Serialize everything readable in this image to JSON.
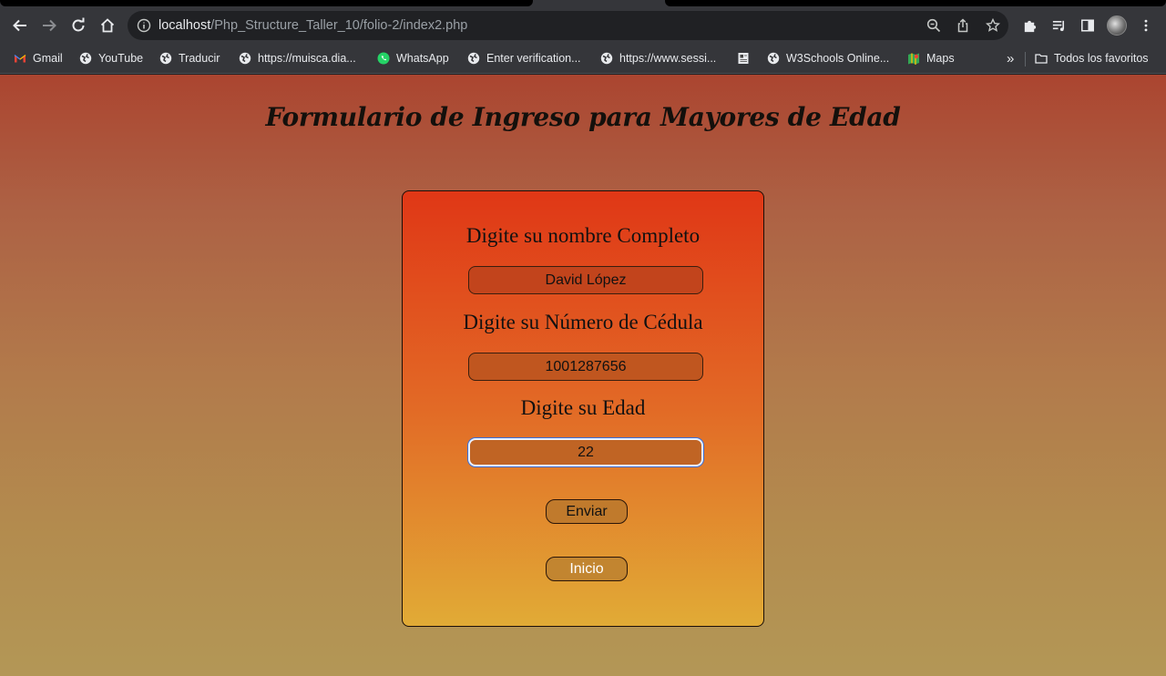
{
  "browser": {
    "url_host": "localhost",
    "url_path": "/Php_Structure_Taller_10/folio-2/index2.php",
    "bookmarks": [
      {
        "label": "Gmail",
        "icon": "gmail-icon"
      },
      {
        "label": "YouTube",
        "icon": "globe-icon"
      },
      {
        "label": "Traducir",
        "icon": "globe-icon"
      },
      {
        "label": "https://muisca.dia...",
        "icon": "globe-icon"
      },
      {
        "label": "WhatsApp",
        "icon": "whatsapp-icon"
      },
      {
        "label": "Enter verification...",
        "icon": "globe-icon"
      },
      {
        "label": "https://www.sessi...",
        "icon": "globe-icon"
      },
      {
        "label": "",
        "icon": "page-icon"
      },
      {
        "label": "W3Schools Online...",
        "icon": "globe-icon"
      },
      {
        "label": "Maps",
        "icon": "maps-icon"
      }
    ],
    "overflow_label": "»",
    "all_bookmarks_label": "Todos los favoritos"
  },
  "page": {
    "title": "Formulario de Ingreso para Mayores de Edad",
    "form": {
      "name_label": "Digite su nombre Completo",
      "name_value": "David López",
      "id_label": "Digite su Número de Cédula",
      "id_value": "1001287656",
      "age_label": "Digite su Edad",
      "age_value": "22",
      "submit_label": "Enviar",
      "home_label": "Inicio"
    }
  },
  "colors": {
    "chrome_bg": "#35363a",
    "omnibox_bg": "#202124",
    "card_top": "#e03716",
    "card_bottom": "#e1ab36",
    "focus_ring": "#3b6fd8"
  }
}
